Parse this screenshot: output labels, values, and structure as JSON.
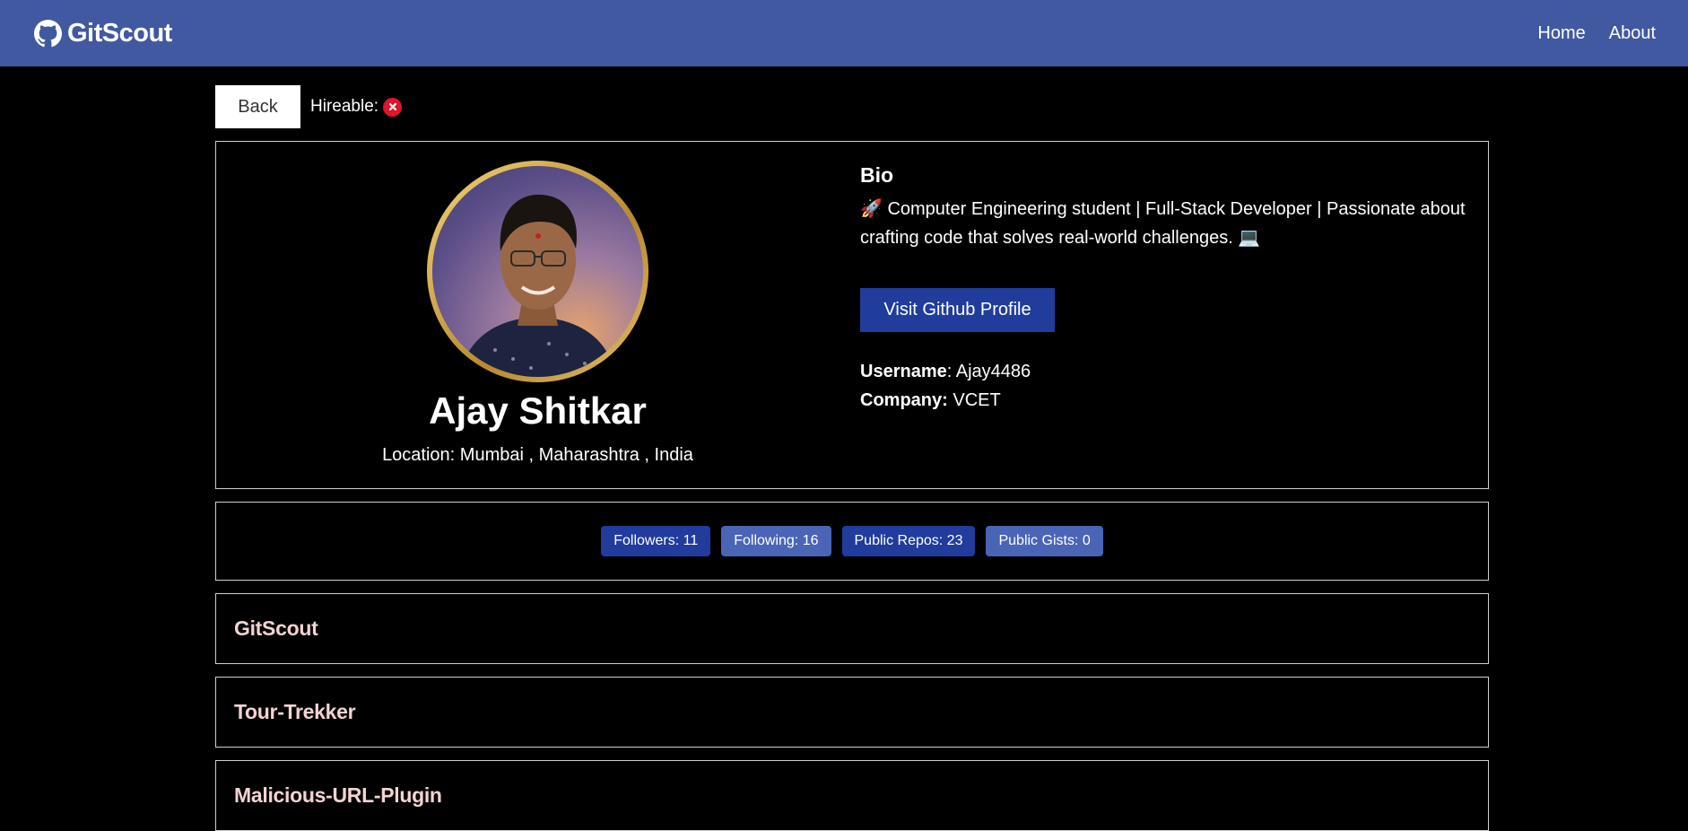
{
  "navbar": {
    "brand": "GitScout",
    "links": [
      "Home",
      "About"
    ]
  },
  "topbar": {
    "back_label": "Back",
    "hireable_label": "Hireable:"
  },
  "profile": {
    "name": "Ajay Shitkar",
    "location": "Location: Mumbai , Maharashtra , India",
    "bio_title": "Bio",
    "bio": "🚀 Computer Engineering student | Full-Stack Developer | Passionate about crafting code that solves real-world challenges. 💻",
    "visit_button": "Visit Github Profile",
    "username_label": "Username",
    "username": ": Ajay4486",
    "company_label": "Company:",
    "company": " VCET"
  },
  "stats": {
    "followers": "Followers: 11",
    "following": "Following: 16",
    "public_repos": "Public Repos: 23",
    "public_gists": "Public Gists: 0"
  },
  "repos": [
    "GitScout",
    "Tour-Trekker",
    "Malicious-URL-Plugin"
  ]
}
